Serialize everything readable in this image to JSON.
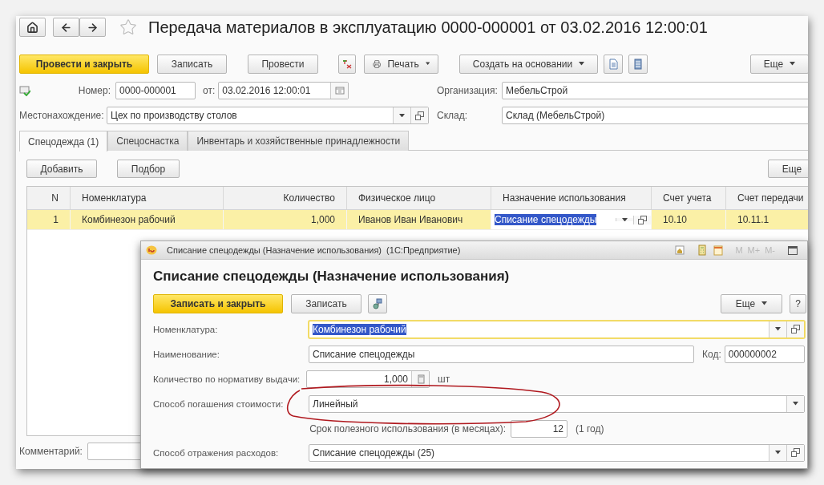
{
  "main_window": {
    "nav": {
      "title": "Передача материалов в эксплуатацию 0000-000001 от 03.02.2016 12:00:01",
      "favorite": false
    },
    "toolbar": {
      "buttons": [
        {
          "label": "Провести и закрыть",
          "kind": "default"
        },
        {
          "label": "Записать",
          "kind": "plain"
        },
        {
          "label": "Провести",
          "kind": "plain"
        }
      ],
      "print_button": "Печать",
      "create_button": "Создать на основании",
      "more_button": "Еще"
    },
    "header": {
      "number_label": "Номер:",
      "number": "0000-000001",
      "date_label": "от:",
      "date": "03.02.2016 12:00:01",
      "organization_label": "Организация:",
      "organization": "МебельСтрой",
      "location_label": "Местонахождение:",
      "location": "Цех по производству столов",
      "warehouse_label": "Склад:",
      "warehouse": "Склад (МебельСтрой)"
    },
    "tabs": [
      {
        "label": "Спецодежда (1)",
        "selected": true
      },
      {
        "label": "Спецоснастка",
        "selected": false
      },
      {
        "label": "Инвентарь и хозяйственные принадлежности",
        "selected": false
      }
    ],
    "table_toolbar": {
      "buttons": [
        "Добавить",
        "Подбор"
      ],
      "more_button": "Еще"
    },
    "table": {
      "columns": [
        "N",
        "Номенклатура",
        "Количество",
        "Физическое лицо",
        "Назначение использования",
        "Счет учета",
        "Счет передачи"
      ],
      "rows": [
        {
          "selected": true,
          "cells": [
            {
              "text": "1",
              "editing": false
            },
            {
              "text": "Комбинезон рабочий",
              "editing": false
            },
            {
              "text": "1,000",
              "editing": false
            },
            {
              "text": "Иванов Иван Иванович",
              "editing": false
            },
            {
              "text": "Списание спецодежды",
              "editing": true
            },
            {
              "text": "10.10",
              "editing": false
            },
            {
              "text": "10.11.1",
              "editing": false
            }
          ]
        }
      ]
    },
    "comment_label": "Комментарий:"
  },
  "dialog": {
    "title": "Списание спецодежды (Назначение использования)  (1С:Предприятие)",
    "titlebar_buttons": [
      "M",
      "M+",
      "M-"
    ],
    "heading": "Списание спецодежды (Назначение использования)",
    "toolbar": {
      "save_close": "Записать и закрыть",
      "save": "Записать",
      "more": "Еще",
      "help": "?"
    },
    "fields": [
      {
        "kind": "select",
        "label": "Номенклатура:",
        "value": "Комбинезон рабочий",
        "focused": true
      },
      {
        "kind": "textcode",
        "label": "Наименование:",
        "value": "Списание спецодежды",
        "code_label": "Код:",
        "code": "000000002"
      },
      {
        "kind": "number",
        "label": "Количество по нормативу выдачи:",
        "value": "1,000",
        "unit": "шт"
      },
      {
        "kind": "dropdown",
        "label": "Способ погашения стоимости:",
        "value": "Линейный"
      },
      {
        "kind": "term",
        "label": "Срок полезного использования (в месяцах):",
        "value": "12",
        "note": "(1 год)"
      },
      {
        "kind": "select",
        "label": "Способ отражения расходов:",
        "value": "Списание спецодежды (25)",
        "focused": false
      }
    ]
  }
}
